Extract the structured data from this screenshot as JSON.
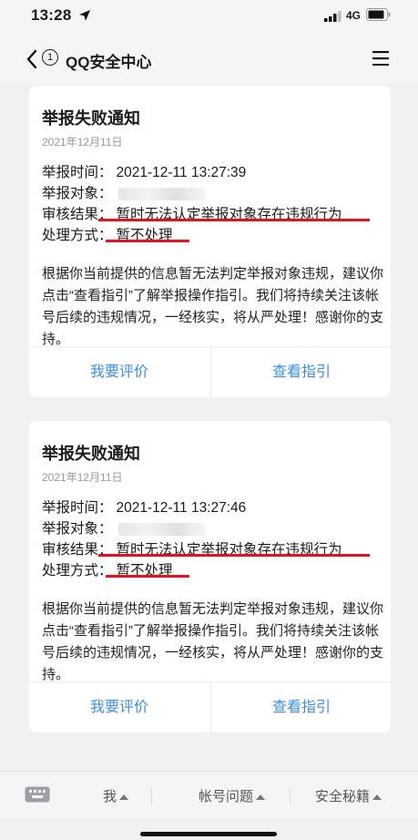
{
  "status_bar": {
    "time": "13:28",
    "network": "4G"
  },
  "nav": {
    "back_badge": "1",
    "title": "QQ安全中心"
  },
  "cards": [
    {
      "title": "举报失败通知",
      "date": "2021年12月11日",
      "time_label": "举报时间：",
      "time_value": "2021-12-11 13:27:39",
      "target_label": "举报对象：",
      "result_label": "审核结果：",
      "result_value": "暂时无法认定举报对象存在违规行为",
      "handling_label": "处理方式：",
      "handling_value": "暂不处理",
      "paragraph": "根据你当前提供的信息暂无法判定举报对象违规，建议你点击“查看指引”了解举报操作指引。我们将持续关注该帐号后续的违规情况，一经核实，将从严处理！感谢你的支持。",
      "rate_button": "我要评价",
      "guide_button": "查看指引"
    },
    {
      "title": "举报失败通知",
      "date": "2021年12月11日",
      "time_label": "举报时间：",
      "time_value": "2021-12-11 13:27:46",
      "target_label": "举报对象：",
      "result_label": "审核结果：",
      "result_value": "暂时无法认定举报对象存在违规行为",
      "handling_label": "处理方式：",
      "handling_value": "暂不处理",
      "paragraph": "根据你当前提供的信息暂无法判定举报对象违规，建议你点击“查看指引”了解举报操作指引。我们将持续关注该帐号后续的违规情况，一经核实，将从严处理！感谢你的支持。",
      "rate_button": "我要评价",
      "guide_button": "查看指引"
    }
  ],
  "bottom_menu": {
    "tab_me": "我",
    "tab_account": "帐号问题",
    "tab_secrets": "安全秘籍"
  },
  "colors": {
    "link": "#3a8ee6",
    "underline": "#e8101f",
    "background": "#f1f1f4"
  },
  "icons": [
    "location-arrow-icon",
    "signal-icon",
    "battery-icon",
    "back-chevron-icon",
    "menu-icon",
    "keyboard-icon",
    "caret-up-icon"
  ]
}
